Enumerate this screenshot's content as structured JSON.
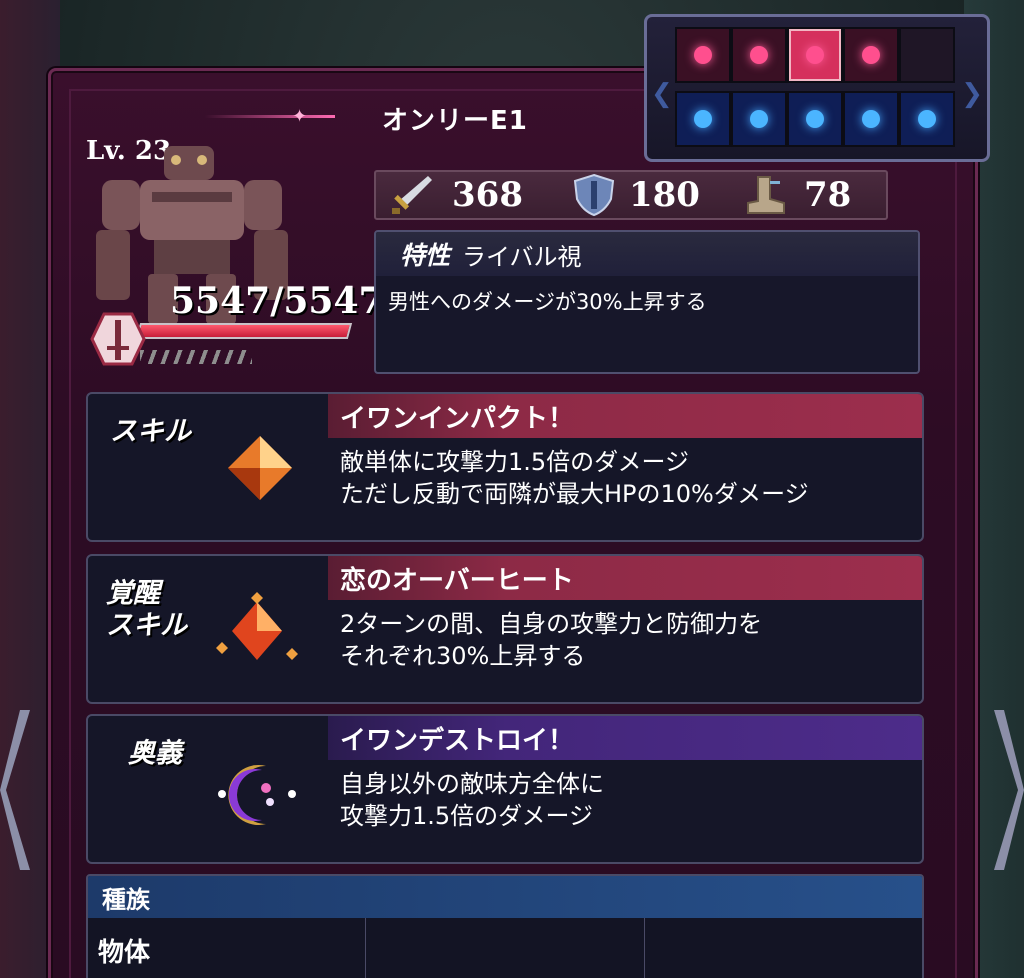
{
  "unit": {
    "name": "オンリーE1",
    "level": "Lv. 23",
    "hp": "5547/5547",
    "hp_ratio": 1.0
  },
  "formation": {
    "top": [
      "pink",
      "pink",
      "pink-active",
      "pink",
      "empty"
    ],
    "bottom": [
      "blue",
      "blue",
      "blue",
      "blue",
      "blue"
    ]
  },
  "stats": {
    "attack": "368",
    "defense": "180",
    "speed": "78",
    "attack_icon": "sword-icon",
    "defense_icon": "shield-icon",
    "speed_icon": "boot-icon"
  },
  "trait": {
    "tag": "特性",
    "name": "ライバル視",
    "desc": "男性へのダメージが30%上昇する"
  },
  "skill": {
    "label": "スキル",
    "name": "イワンインパクト！",
    "desc": "敵単体に攻撃力1.5倍のダメージ\nただし反動で両隣が最大HPの10%ダメージ"
  },
  "awaken": {
    "label": "覚醒\n スキル",
    "name": "恋のオーバーヒート",
    "desc": "2ターンの間、自身の攻撃力と防御力を\nそれぞれ30%上昇する"
  },
  "ultimate": {
    "label": "奥義",
    "name": "イワンデストロイ！",
    "desc": "自身以外の敵味方全体に\n攻撃力1.5倍のダメージ"
  },
  "species": {
    "header": "種族",
    "values": [
      "物体",
      "",
      ""
    ]
  },
  "colors": {
    "panel": "#2d0c24",
    "skill_header": "#9c2e4d",
    "ultimate_header": "#4d2c8a",
    "species_header": "#27508a"
  }
}
